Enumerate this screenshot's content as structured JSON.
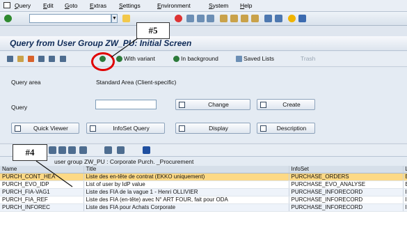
{
  "menubar": {
    "items": [
      "Query",
      "Edit",
      "Goto",
      "Extras",
      "Settings",
      "Environment",
      "System",
      "Help"
    ]
  },
  "title": "Query from User Group ZW_PU: Initial Screen",
  "app_toolbar": {
    "with_variant": "With variant",
    "in_background": "In background",
    "saved_lists": "Saved Lists",
    "trash": "Trash"
  },
  "form": {
    "query_area_label": "Query area",
    "query_area_value": "Standard Area (Client-specific)",
    "query_label": "Query",
    "query_value": "",
    "buttons": {
      "change": "Change",
      "create": "Create",
      "quick_viewer": "Quick Viewer",
      "infoset_query": "InfoSet Query",
      "display": "Display",
      "description": "Description"
    }
  },
  "grid": {
    "caption": "user group ZW_PU : Corporate Purch. _Procurement",
    "columns": [
      "Name",
      "Title",
      "InfoSet",
      "L"
    ],
    "rows": [
      [
        "PURCH_CONT_HEA",
        "Liste des en-tête de contrat (EKKO uniquement)",
        "PURCHASE_ORDERS",
        "E"
      ],
      [
        "PURCH_EVO_IDP",
        "List of user by IdP value",
        "PURCHASE_EVO_ANALYSE",
        "E"
      ],
      [
        "PURCH_FIA-VAG1",
        "Liste des FIA de la vague 1 - Henri OLLIVIER",
        "PURCHASE_INFORECORD",
        "I"
      ],
      [
        "PURCH_FIA_REF",
        "Liste des FIA (en-tête) avec N° ART FOUR, fait pour ODA",
        "PURCHASE_INFORECORD",
        "I"
      ],
      [
        "PURCH_INFOREC",
        "Liste des FIA pour Achats Corporate",
        "PURCHASE_INFORECORD",
        "I"
      ]
    ]
  },
  "callouts": {
    "step5": "#5",
    "step4": "#4"
  },
  "colors": {
    "selected_row": "#fdd985",
    "title": "#0e2a57",
    "highlight_circle": "#e00000"
  }
}
